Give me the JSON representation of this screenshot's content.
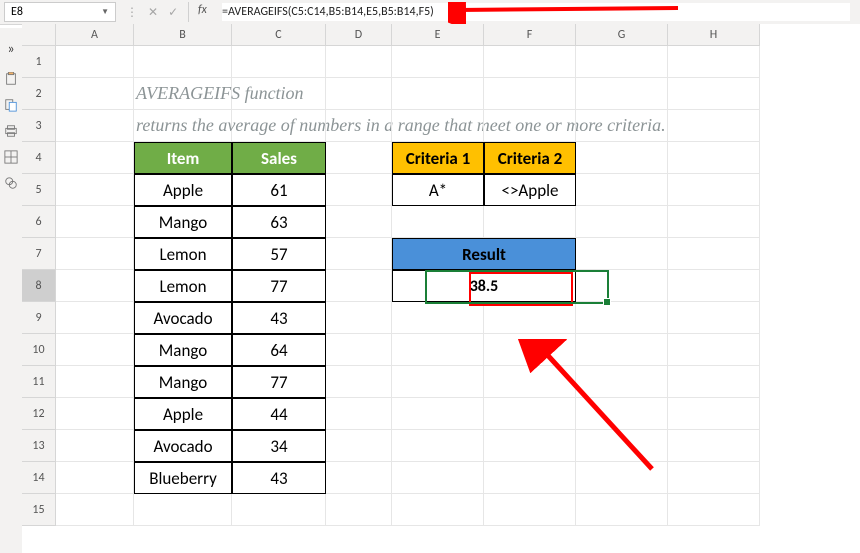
{
  "namebox": "E8",
  "formula": "=AVERAGEIFS(C5:C14,B5:B14,E5,B5:B14,F5)",
  "fx_label": "fx",
  "columns": [
    "A",
    "B",
    "C",
    "D",
    "E",
    "F",
    "G",
    "H"
  ],
  "rows": [
    "1",
    "2",
    "3",
    "4",
    "5",
    "6",
    "7",
    "8",
    "9",
    "10",
    "11",
    "12",
    "13",
    "14",
    "15"
  ],
  "text": {
    "title1": "AVERAGEIFS function",
    "title2": "returns the average of numbers in a range that meet one or more criteria."
  },
  "table": {
    "headers": [
      "Item",
      "Sales"
    ],
    "rows": [
      [
        "Apple",
        "61"
      ],
      [
        "Mango",
        "63"
      ],
      [
        "Lemon",
        "57"
      ],
      [
        "Lemon",
        "77"
      ],
      [
        "Avocado",
        "43"
      ],
      [
        "Mango",
        "64"
      ],
      [
        "Mango",
        "77"
      ],
      [
        "Apple",
        "44"
      ],
      [
        "Avocado",
        "34"
      ],
      [
        "Blueberry",
        "43"
      ]
    ]
  },
  "criteria": {
    "headers": [
      "Criteria 1",
      "Criteria 2"
    ],
    "values": [
      "A*",
      "<>Apple"
    ]
  },
  "result": {
    "header": "Result",
    "value": "38.5"
  },
  "chart_data": {
    "type": "table",
    "title": "AVERAGEIFS function",
    "subtitle": "returns the average of numbers in a range that meet one or more criteria.",
    "columns": [
      "Item",
      "Sales"
    ],
    "rows": [
      [
        "Apple",
        61
      ],
      [
        "Mango",
        63
      ],
      [
        "Lemon",
        57
      ],
      [
        "Lemon",
        77
      ],
      [
        "Avocado",
        43
      ],
      [
        "Mango",
        64
      ],
      [
        "Mango",
        77
      ],
      [
        "Apple",
        44
      ],
      [
        "Avocado",
        34
      ],
      [
        "Blueberry",
        43
      ]
    ],
    "criteria": {
      "Criteria 1": "A*",
      "Criteria 2": "<>Apple"
    },
    "result": 38.5,
    "formula": "=AVERAGEIFS(C5:C14,B5:B14,E5,B5:B14,F5)"
  }
}
